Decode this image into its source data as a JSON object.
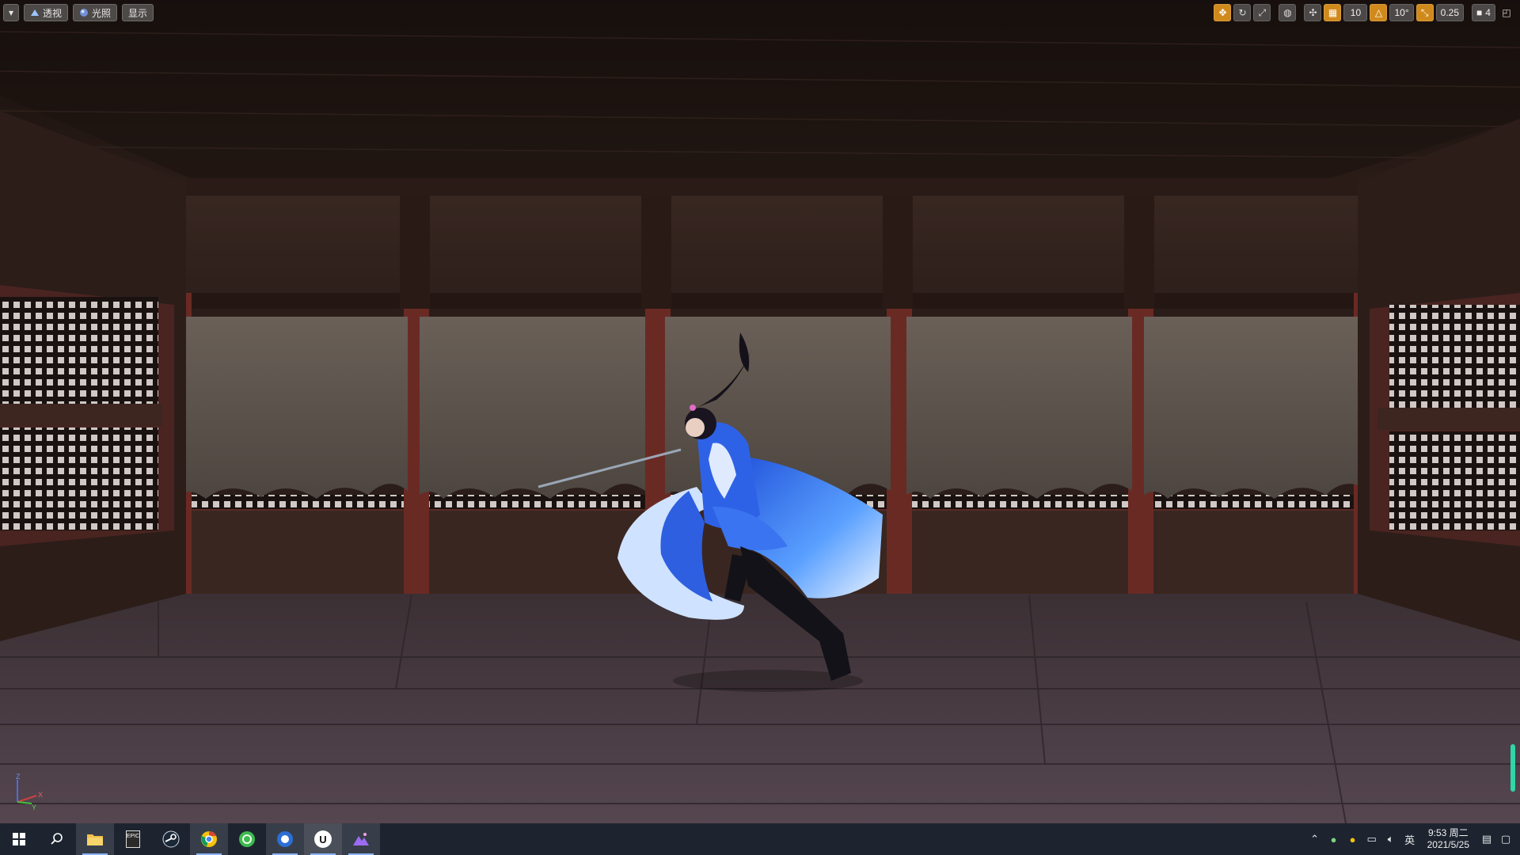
{
  "viewport": {
    "dropdown_icon": "chevron-down-icon",
    "perspective_label": "透视",
    "lighting_label": "光照",
    "show_label": "显示",
    "grid_snap_value": "10",
    "rotation_snap_value": "10°",
    "scale_snap_value": "0.25",
    "camera_speed_value": "4"
  },
  "axis": {
    "x_label": "X",
    "y_label": "Y",
    "z_label": "Z"
  },
  "taskbar": {
    "items": [
      {
        "name": "start",
        "icon": "windows-start-icon"
      },
      {
        "name": "search",
        "icon": "search-icon"
      },
      {
        "name": "file-explorer",
        "icon": "folder-icon"
      },
      {
        "name": "epic-games",
        "icon": "epic-games-icon",
        "label": "EPIC"
      },
      {
        "name": "steam",
        "icon": "steam-icon"
      },
      {
        "name": "chrome",
        "icon": "chrome-icon"
      },
      {
        "name": "green-app",
        "icon": "green-app-icon"
      },
      {
        "name": "blue-app",
        "icon": "blue-app-icon"
      },
      {
        "name": "unreal",
        "icon": "unreal-engine-icon",
        "label": "U"
      },
      {
        "name": "art-app",
        "icon": "mountain-app-icon"
      }
    ],
    "clock_time": "9:53 周二",
    "clock_date": "2021/5/25",
    "ime_label": "英"
  }
}
